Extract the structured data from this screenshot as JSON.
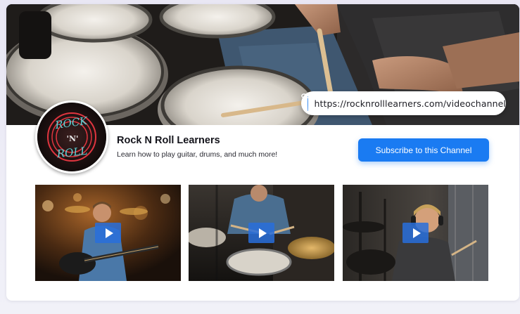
{
  "channel": {
    "url": "https://rocknrolllearners.com/videochannel",
    "name": "Rock N Roll Learners",
    "description": "Learn how to play guitar, drums, and much more!",
    "subscribe_label": "Subscribe to this Channel",
    "logo_text": {
      "top": "ROCK",
      "middle": "'N'",
      "bottom": "ROLL"
    }
  },
  "videos": [
    {
      "subject": "guitarist playing electric guitar"
    },
    {
      "subject": "drummer playing drum kit"
    },
    {
      "subject": "smiling drummer with headphones"
    }
  ],
  "colors": {
    "accent": "#1a7bf2",
    "link_icon": "#3d8ef0",
    "play_overlay": "#286edc",
    "logo_red": "#e0353f",
    "logo_teal": "#5fd3d6"
  }
}
